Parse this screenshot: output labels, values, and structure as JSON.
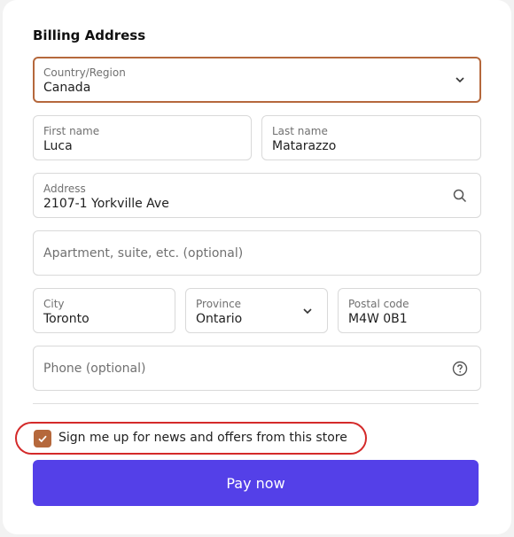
{
  "billing": {
    "title": "Billing Address",
    "country": {
      "label": "Country/Region",
      "value": "Canada"
    },
    "first_name": {
      "label": "First name",
      "value": "Luca"
    },
    "last_name": {
      "label": "Last name",
      "value": "Matarazzo"
    },
    "address": {
      "label": "Address",
      "value": "2107-1 Yorkville Ave"
    },
    "apartment": {
      "placeholder": "Apartment, suite, etc. (optional)"
    },
    "city": {
      "label": "City",
      "value": "Toronto"
    },
    "province": {
      "label": "Province",
      "value": "Ontario"
    },
    "postal": {
      "label": "Postal code",
      "value": "M4W 0B1"
    },
    "phone": {
      "placeholder": "Phone (optional)"
    }
  },
  "newsletter": {
    "label": "Sign me up for news and offers from this store",
    "checked": true
  },
  "pay_button": {
    "label": "Pay now"
  },
  "colors": {
    "accent": "#b5683c",
    "primary_button": "#5440e8",
    "highlight_outline": "#d42a2a"
  },
  "icons": [
    "chevron-down-icon",
    "search-icon",
    "help-circle-icon",
    "checkmark-icon"
  ]
}
